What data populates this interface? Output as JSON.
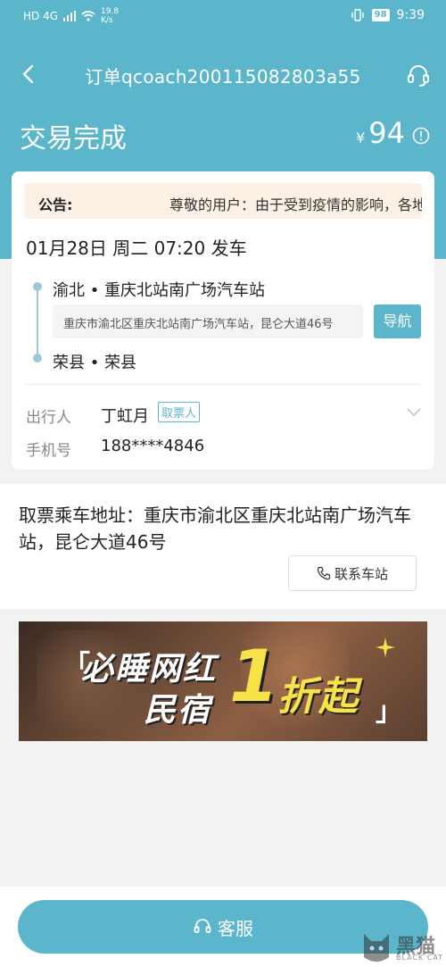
{
  "status_bar": {
    "network": "HD 4G",
    "speed_value": "19.8",
    "speed_unit": "K/s",
    "battery": "98",
    "time": "9:39"
  },
  "nav": {
    "title": "订单qcoach200115082803a55"
  },
  "order": {
    "status": "交易完成",
    "currency": "¥",
    "price": "94"
  },
  "notice": {
    "label": "公告:",
    "text": "尊敬的用户：由于受到疫情的影响，各地"
  },
  "trip": {
    "departure": "01月28日 周二 07:20 发车",
    "from_station": "渝北 • 重庆北站南广场汽车站",
    "from_address": "重庆市渝北区重庆北站南广场汽车站，昆仑大道46号",
    "nav_button": "导航",
    "to_station": "荣县 • 荣县"
  },
  "passenger": {
    "label": "出行人",
    "name": "丁虹月",
    "badge": "取票人",
    "phone_label": "手机号",
    "phone": "188****4846"
  },
  "pickup": {
    "text": "取票乘车地址：重庆市渝北区重庆北站南广场汽车站，昆仑大道46号",
    "contact_button": "联系车站"
  },
  "banner": {
    "quote_open": "「",
    "line1": "必睡网红",
    "line2": "民宿",
    "big": "1",
    "line3": "折起",
    "quote_close": "」"
  },
  "bottom": {
    "cs_button": "客服"
  },
  "watermark": {
    "text": "黑猫",
    "sub": "BLACK CAT"
  },
  "colors": {
    "accent": "#5bb6cc",
    "notice_bg": "#fdf0e5"
  }
}
